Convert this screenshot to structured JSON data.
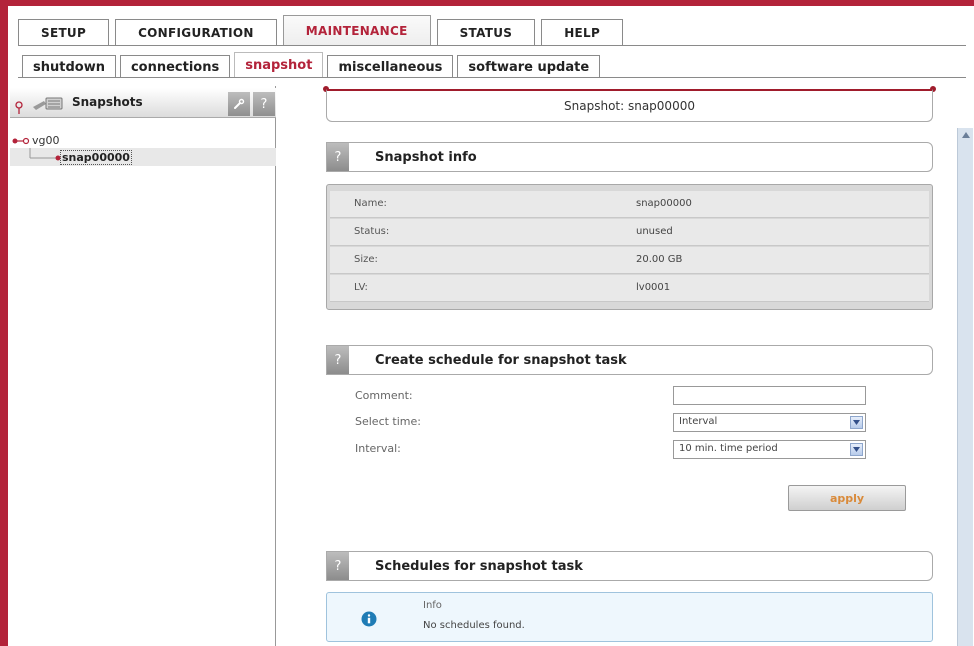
{
  "nav": {
    "main_tabs": [
      {
        "label": "SETUP",
        "active": false
      },
      {
        "label": "CONFIGURATION",
        "active": false
      },
      {
        "label": "MAINTENANCE",
        "active": true
      },
      {
        "label": "STATUS",
        "active": false
      },
      {
        "label": "HELP",
        "active": false
      }
    ],
    "sub_tabs": [
      {
        "label": "shutdown",
        "active": false
      },
      {
        "label": "connections",
        "active": false
      },
      {
        "label": "snapshot",
        "active": true
      },
      {
        "label": "miscellaneous",
        "active": false
      },
      {
        "label": "software update",
        "active": false
      }
    ]
  },
  "sidebar": {
    "title": "Snapshots",
    "wrench_icon": "wrench-icon",
    "help_label": "?",
    "tree": {
      "root_label": "vg00",
      "child_label": "snap00000"
    }
  },
  "main": {
    "title": "Snapshot: snap00000",
    "snapshot_info": {
      "heading": "Snapshot info",
      "help_label": "?",
      "rows": [
        {
          "key": "Name:",
          "value": "snap00000"
        },
        {
          "key": "Status:",
          "value": "unused"
        },
        {
          "key": "Size:",
          "value": "20.00 GB"
        },
        {
          "key": "LV:",
          "value": "lv0001"
        }
      ]
    },
    "schedule_form": {
      "heading": "Create schedule for snapshot task",
      "help_label": "?",
      "comment_label": "Comment:",
      "comment_value": "",
      "select_time_label": "Select time:",
      "select_time_value": "Interval",
      "interval_label": "Interval:",
      "interval_value": "10 min. time period",
      "apply_label": "apply"
    },
    "schedules": {
      "heading": "Schedules for snapshot task",
      "help_label": "?",
      "info_title": "Info",
      "info_message": "No schedules found."
    }
  },
  "colors": {
    "accent": "#b3233a",
    "apply_text": "#d98a3a",
    "info_bg": "#eef7fd"
  }
}
